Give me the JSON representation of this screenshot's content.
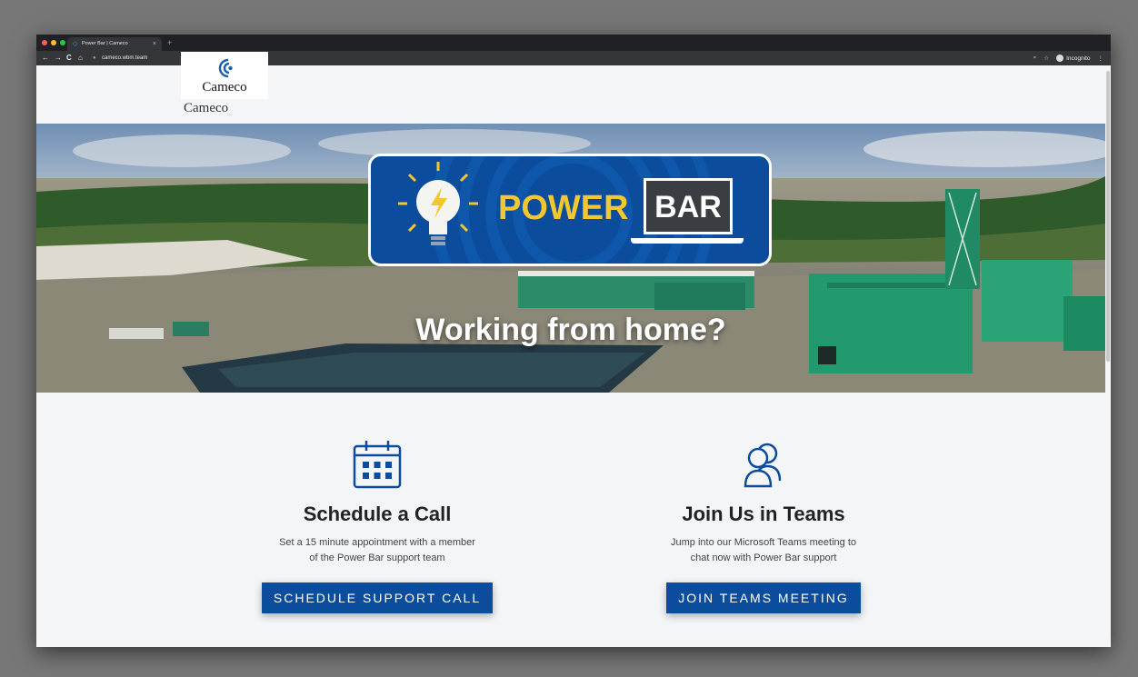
{
  "browser": {
    "tab_title": "Power Bar | Cameco",
    "tab_close": "×",
    "new_tab": "+",
    "url": "cameco.wbm.team",
    "nav_back": "←",
    "nav_forward": "→",
    "nav_reload": "C",
    "nav_home": "⌂",
    "profile": "Incognito",
    "menu": "⋮"
  },
  "header": {
    "logo_text": "Cameco",
    "logo_text_2": "Cameco"
  },
  "hero": {
    "badge_word_1": "POWER",
    "badge_word_2": "BAR",
    "title": "Working from home?"
  },
  "cards": [
    {
      "title": "Schedule a Call",
      "line_1": "Set a 15 minute appointment with a member",
      "line_2": "of the Power Bar support team",
      "button": "SCHEDULE SUPPORT CALL"
    },
    {
      "title": "Join Us in Teams",
      "line_1": "Jump into our Microsoft Teams meeting to",
      "line_2": "chat now with Power Bar support",
      "button": "JOIN TEAMS MEETING"
    }
  ],
  "colors": {
    "brand_blue": "#0b4d9c",
    "badge_yellow": "#f4c62f",
    "page_background": "#f4f5f7"
  }
}
